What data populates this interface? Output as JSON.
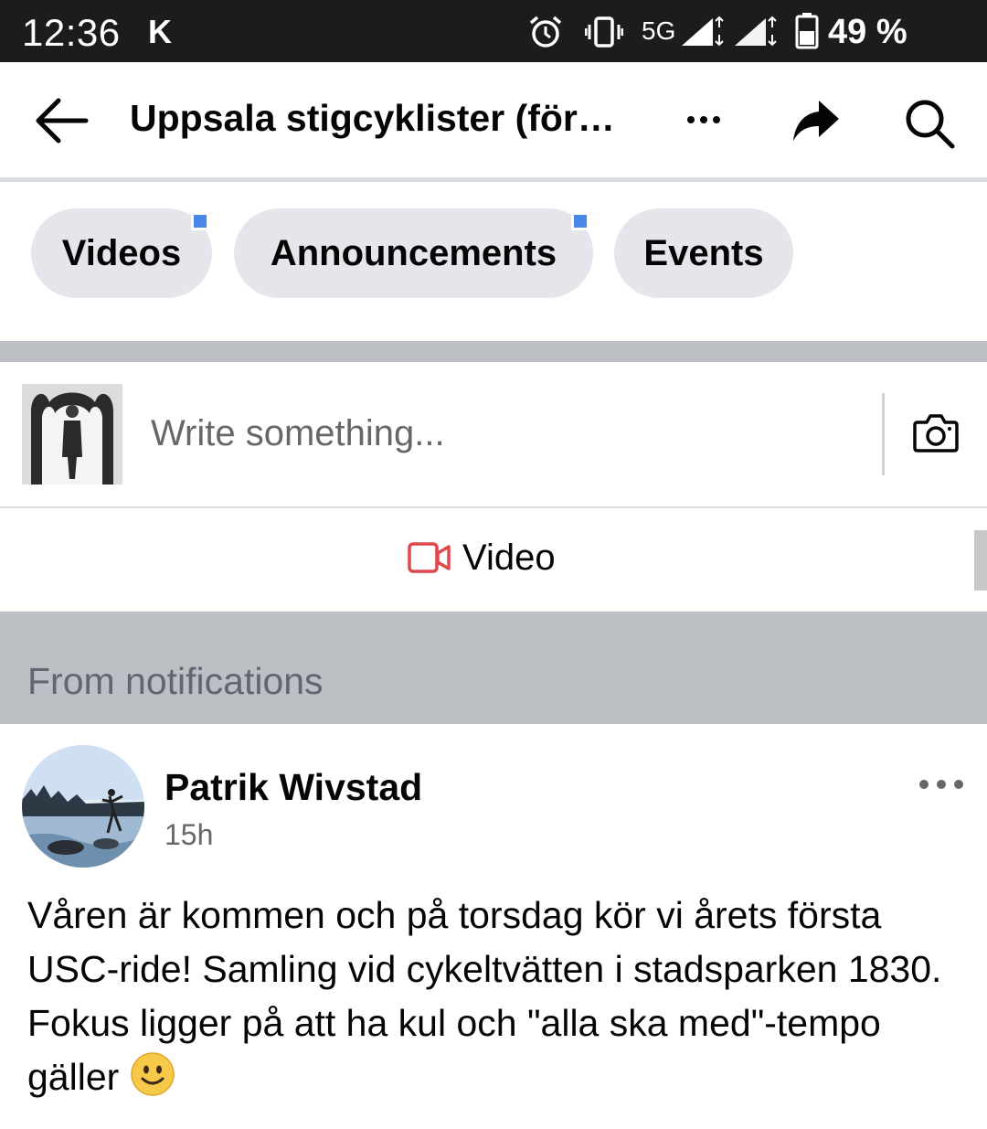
{
  "status_bar": {
    "time": "12:36",
    "carrier_glyph": "K",
    "network": "5G",
    "battery": "49 %",
    "icons": [
      "alarm-icon",
      "vibrate-icon",
      "signal-icon",
      "signal-icon",
      "battery-icon"
    ]
  },
  "header": {
    "title": "Uppsala stigcyklister (förening)",
    "icons": [
      "back-arrow-icon",
      "more-dots-icon",
      "share-icon",
      "search-icon"
    ]
  },
  "chips": [
    {
      "label": "Videos",
      "has_dot": true
    },
    {
      "label": "Announcements",
      "has_dot": true
    },
    {
      "label": "Events",
      "has_dot": false
    }
  ],
  "composer": {
    "placeholder": "Write something...",
    "video_label": "Video",
    "icons": [
      "camera-icon",
      "video-camera-icon"
    ]
  },
  "section": {
    "label": "From notifications"
  },
  "post": {
    "author": "Patrik Wivstad",
    "time": "15h",
    "text": "Våren är kommen och på torsdag kör vi årets första  USC-ride! Samling vid cykeltvätten i stadsparken 1830. Fokus ligger på att ha kul och \"alla ska med\"-tempo gäller",
    "emoji": "slightly-smiling-face"
  },
  "colors": {
    "status_bar": "#1c1c1c",
    "chip_bg": "#e4e6eb",
    "chip_dot": "#4a86e8",
    "divider": "#bcc0c4",
    "video_icon": "#e0474c",
    "secondary_text": "#65676b"
  }
}
